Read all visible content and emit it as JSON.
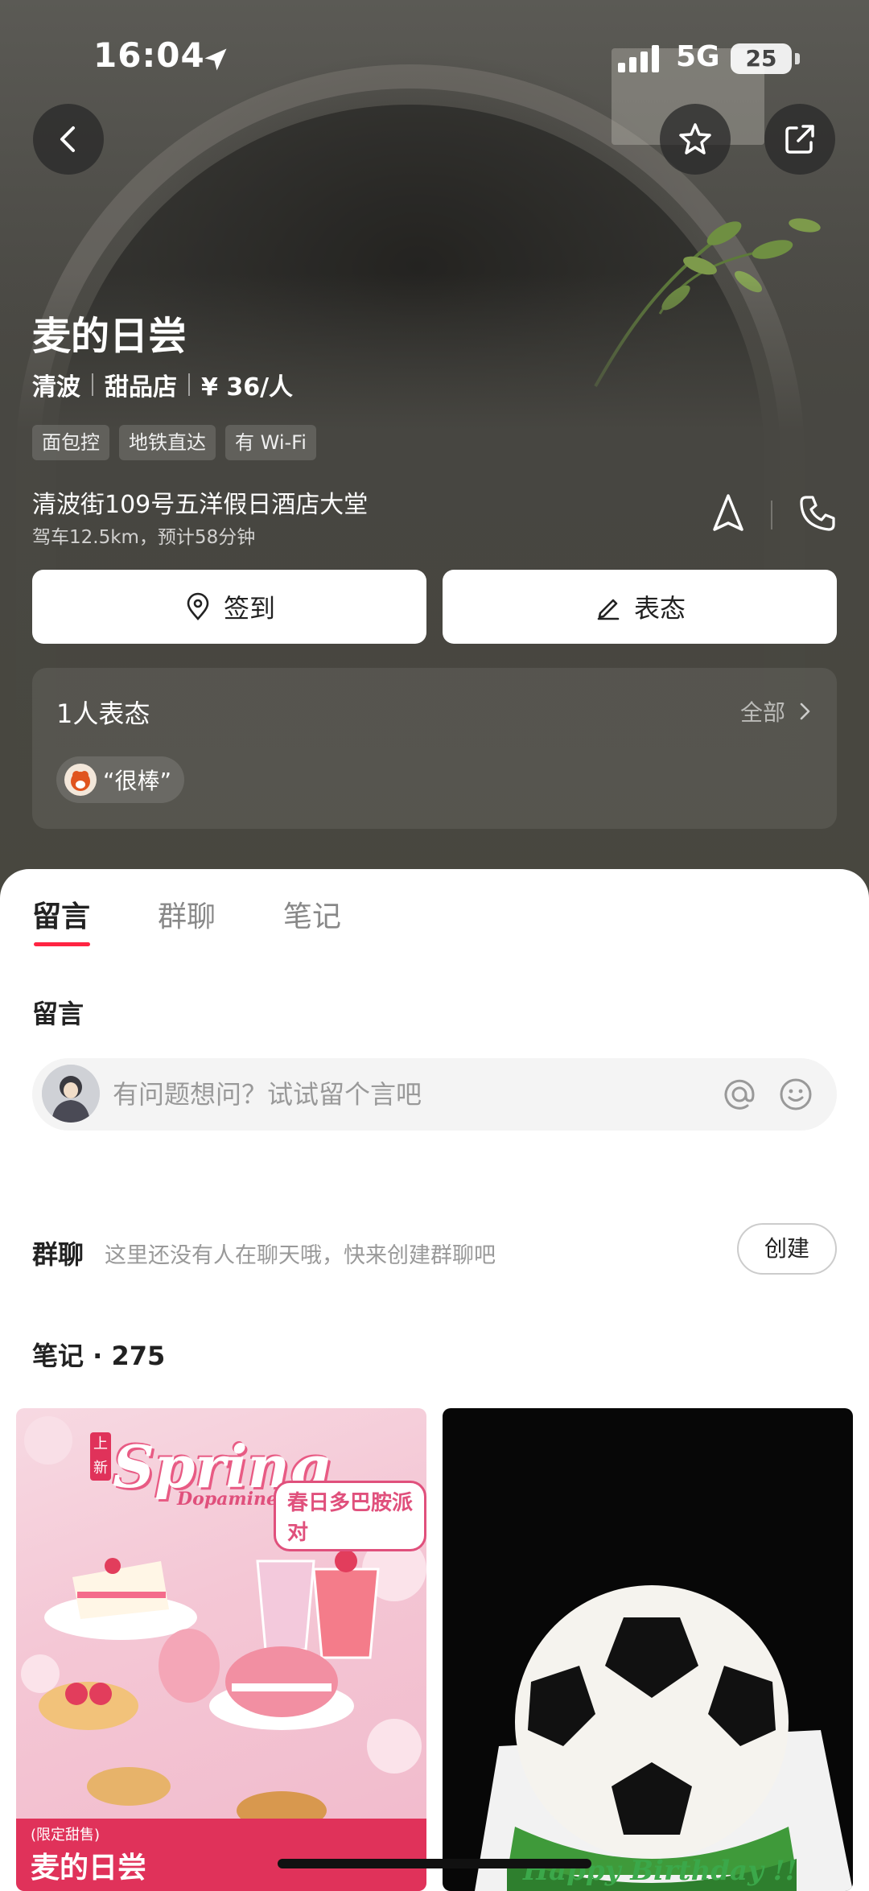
{
  "status_bar": {
    "time": "16:04",
    "network": "5G",
    "battery": "25"
  },
  "shop": {
    "name": "麦的日尝",
    "area": "清波",
    "category": "甜品店",
    "price": "¥ 36/人",
    "tags": [
      "面包控",
      "地铁直达",
      "有 Wi-Fi"
    ],
    "address": "清波街109号五洋假日酒店大堂",
    "drive_info": "驾车12.5km，预计58分钟"
  },
  "actions": {
    "checkin": "签到",
    "express": "表态"
  },
  "opinions": {
    "title": "1人表态",
    "all_label": "全部",
    "chips": [
      {
        "text": "“很棒”"
      }
    ]
  },
  "tabs": [
    {
      "label": "留言",
      "active": true
    },
    {
      "label": "群聊",
      "active": false
    },
    {
      "label": "笔记",
      "active": false
    }
  ],
  "comments": {
    "title": "留言",
    "placeholder": "有问题想问？试试留个言吧"
  },
  "group_chat": {
    "label": "群聊",
    "hint": "这里还没有人在聊天哦，快来创建群聊吧",
    "create_label": "创建"
  },
  "notes": {
    "title": "笔记 · 275",
    "cards": [
      {
        "new_badge": "上新",
        "headline": "Spring",
        "subline": "Dopamine",
        "badge": "春日多巴胺派对",
        "limited": "(限定甜售)",
        "brand": "麦的日尝"
      },
      {
        "caption": "Happy Birthday !!"
      }
    ]
  },
  "colors": {
    "accent": "#ff2442",
    "hero_bg": "#48473f",
    "pink": "#e0325a"
  }
}
